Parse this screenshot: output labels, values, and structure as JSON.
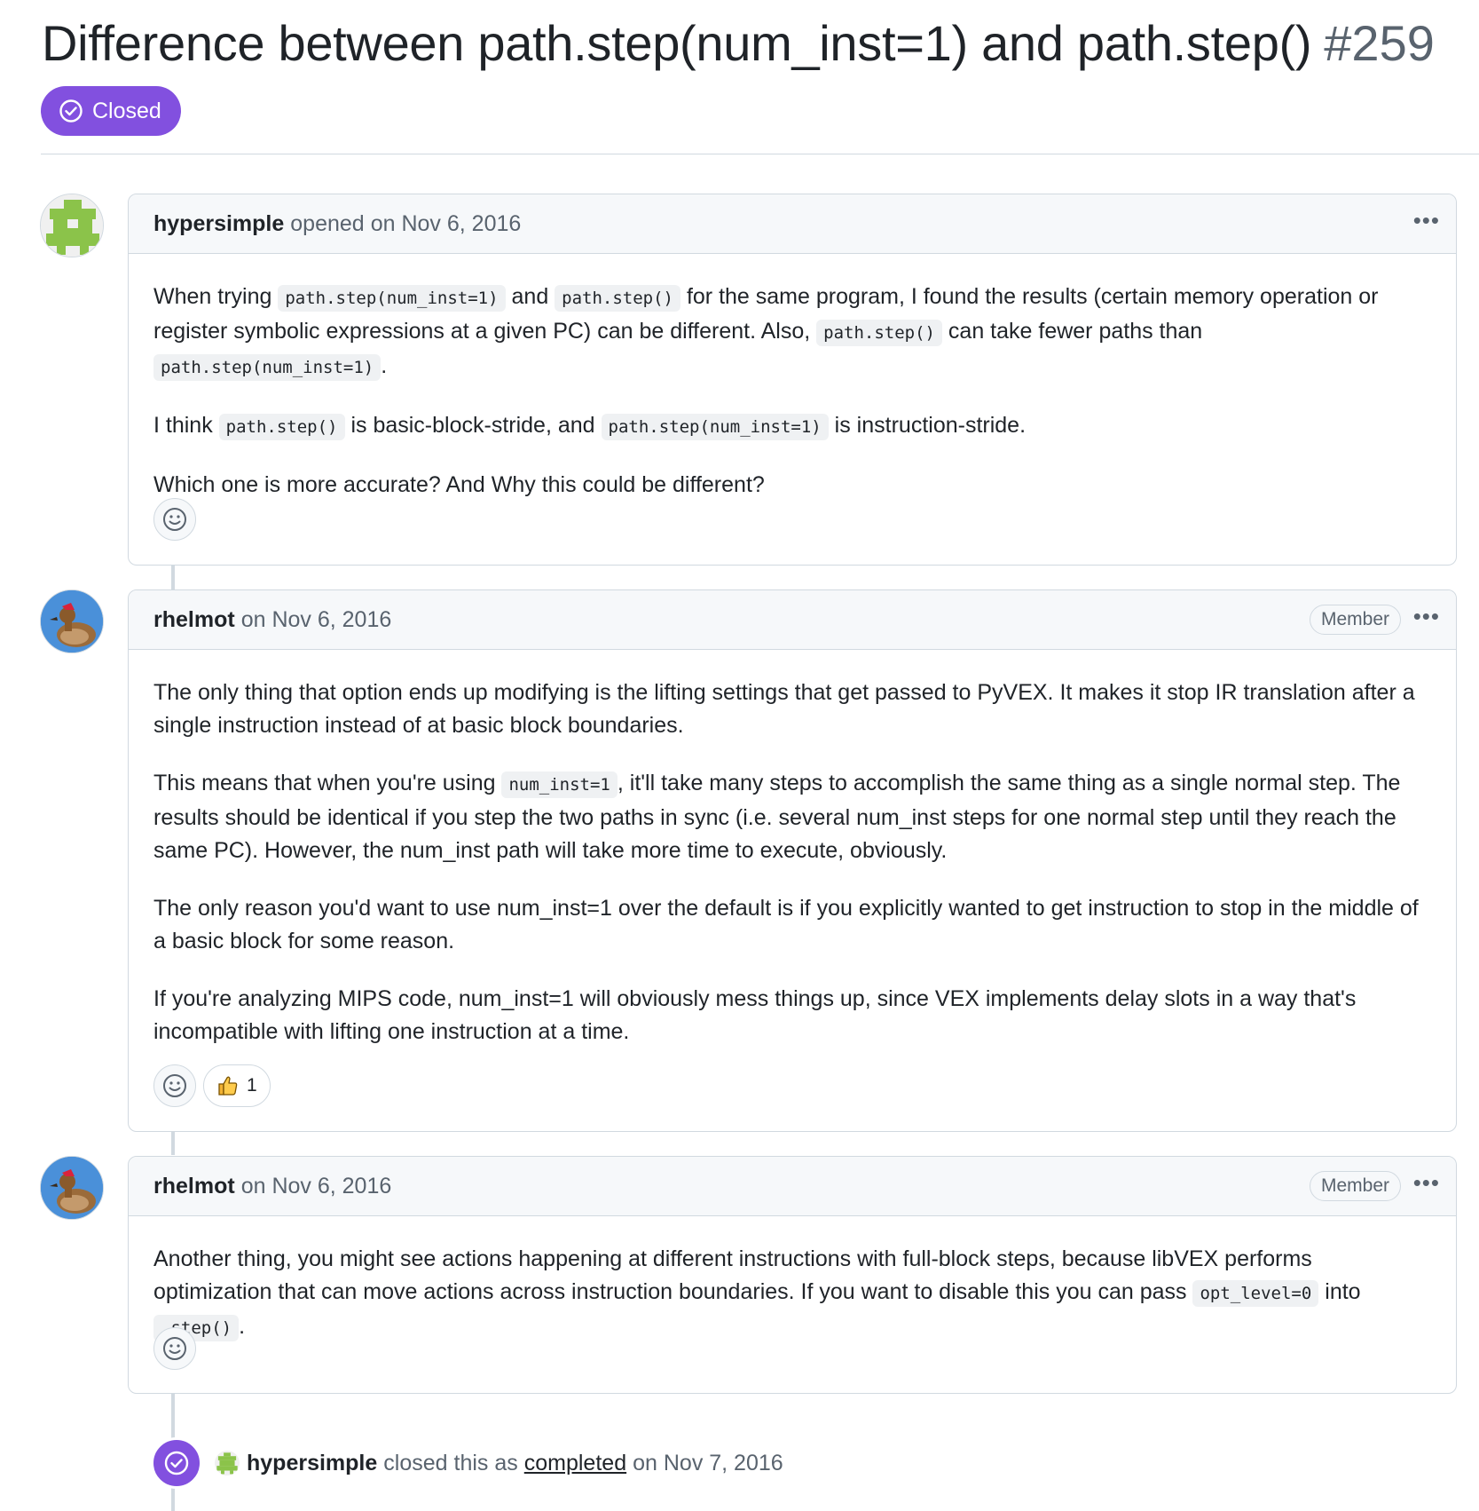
{
  "issue": {
    "title": "Difference between path.step(num_inst=1) and path.step()",
    "number": "#259",
    "state": "Closed"
  },
  "comments": [
    {
      "author": "hypersimple",
      "action": "opened",
      "date": "on Nov 6, 2016",
      "avatar": "green-pixel-identicon",
      "body": {
        "p1_a": "When trying ",
        "p1_code1": "path.step(num_inst=1)",
        "p1_b": " and ",
        "p1_code2": "path.step()",
        "p1_c": " for the same program, I found the results (certain memory operation or register symbolic expressions at a given PC) can be different. Also, ",
        "p1_code3": "path.step()",
        "p1_d": " can take fewer paths than ",
        "p1_code4": "path.step(num_inst=1)",
        "p1_e": ".",
        "p2_a": "I think ",
        "p2_code1": "path.step()",
        "p2_b": " is basic-block-stride, and ",
        "p2_code2": "path.step(num_inst=1)",
        "p2_c": " is instruction-stride.",
        "p3": "Which one is more accurate? And Why this could be different?"
      }
    },
    {
      "author": "rhelmot",
      "date": "on Nov 6, 2016",
      "role": "Member",
      "avatar": "duck-avatar",
      "body": {
        "p1": "The only thing that option ends up modifying is the lifting settings that get passed to PyVEX. It makes it stop IR translation after a single instruction instead of at basic block boundaries.",
        "p2_a": "This means that when you're using ",
        "p2_code": "num_inst=1",
        "p2_b": ", it'll take many steps to accomplish the same thing as a single normal step. The results should be identical if you step the two paths in sync (i.e. several num_inst steps for one normal step until they reach the same PC). However, the num_inst path will take more time to execute, obviously.",
        "p3": "The only reason you'd want to use num_inst=1 over the default is if you explicitly wanted to get instruction to stop in the middle of a basic block for some reason.",
        "p4": "If you're analyzing MIPS code, num_inst=1 will obviously mess things up, since VEX implements delay slots in a way that's incompatible with lifting one instruction at a time."
      },
      "reaction": {
        "emoji": "thumbs-up",
        "count": "1"
      }
    },
    {
      "author": "rhelmot",
      "date": "on Nov 6, 2016",
      "role": "Member",
      "avatar": "duck-avatar",
      "body": {
        "p1_a": "Another thing, you might see actions happening at different instructions with full-block steps, because libVEX performs optimization that can move actions across instruction boundaries. If you want to disable this you can pass ",
        "p1_code1": "opt_level=0",
        "p1_b": " into ",
        "p1_code2": ".step()",
        "p1_c": "."
      }
    }
  ],
  "close_event": {
    "author": "hypersimple",
    "text": "closed this as",
    "link": "completed",
    "date": "on Nov 7, 2016"
  },
  "colors": {
    "closed_purple": "#8250df",
    "border": "#d1d9e0",
    "header_bg": "#f6f8fa",
    "muted_text": "#59636e"
  }
}
